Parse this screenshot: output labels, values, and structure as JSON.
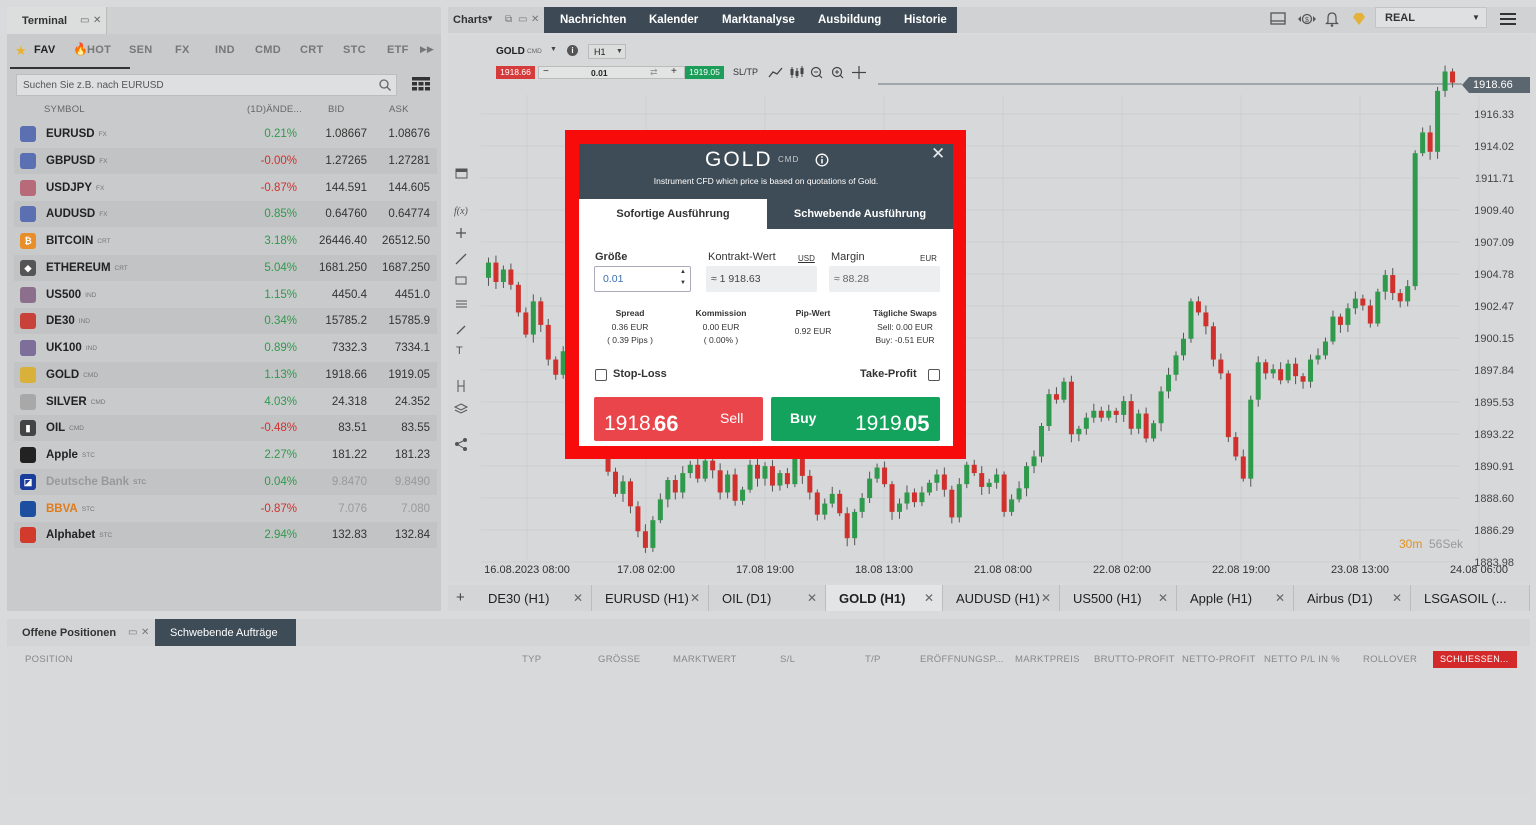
{
  "terminal": {
    "title": "Terminal",
    "categories": [
      {
        "label": "FAV",
        "icon": "star-icon"
      },
      {
        "label": "HOT",
        "icon": "flame-icon"
      },
      {
        "label": "SEN"
      },
      {
        "label": "FX"
      },
      {
        "label": "IND"
      },
      {
        "label": "CMD"
      },
      {
        "label": "CRT"
      },
      {
        "label": "STC"
      },
      {
        "label": "ETF"
      }
    ],
    "search_placeholder": "Suchen Sie z.B. nach EURUSD",
    "columns": {
      "symbol": "SYMBOL",
      "change": "(1D)ÄNDE...",
      "bid": "BID",
      "ask": "ASK"
    },
    "rows": [
      {
        "symbol": "EURUSD",
        "type": "FX",
        "change": "0.21%",
        "bid": "1.08667",
        "ask": "1.08676",
        "dir": "pos",
        "icon": "us-flag-icon",
        "icon_color": "#5b6fb3"
      },
      {
        "symbol": "GBPUSD",
        "type": "FX",
        "change": "-0.00%",
        "bid": "1.27265",
        "ask": "1.27281",
        "dir": "neg",
        "icon": "us-flag-icon",
        "icon_color": "#5b6fb3"
      },
      {
        "symbol": "USDJPY",
        "type": "FX",
        "change": "-0.87%",
        "bid": "144.591",
        "ask": "144.605",
        "dir": "neg",
        "icon": "us-flag-icon",
        "icon_color": "#b76a7a"
      },
      {
        "symbol": "AUDUSD",
        "type": "FX",
        "change": "0.85%",
        "bid": "0.64760",
        "ask": "0.64774",
        "dir": "pos",
        "icon": "us-flag-icon",
        "icon_color": "#5b6fb3"
      },
      {
        "symbol": "BITCOIN",
        "type": "CRT",
        "change": "3.18%",
        "bid": "26446.40",
        "ask": "26512.50",
        "dir": "pos",
        "icon": "bitcoin-icon",
        "icon_color": "#e88f2a"
      },
      {
        "symbol": "ETHEREUM",
        "type": "CRT",
        "change": "5.04%",
        "bid": "1681.250",
        "ask": "1687.250",
        "dir": "pos",
        "icon": "ethereum-icon",
        "icon_color": "#555555"
      },
      {
        "symbol": "US500",
        "type": "IND",
        "change": "1.15%",
        "bid": "4450.4",
        "ask": "4451.0",
        "dir": "pos",
        "icon": "us-flag-icon",
        "icon_color": "#8b6f8c"
      },
      {
        "symbol": "DE30",
        "type": "IND",
        "change": "0.34%",
        "bid": "15785.2",
        "ask": "15785.9",
        "dir": "pos",
        "icon": "de-flag-icon",
        "icon_color": "#c9423a"
      },
      {
        "symbol": "UK100",
        "type": "IND",
        "change": "0.89%",
        "bid": "7332.3",
        "ask": "7334.1",
        "dir": "pos",
        "icon": "uk-flag-icon",
        "icon_color": "#7d6f99"
      },
      {
        "symbol": "GOLD",
        "type": "CMD",
        "change": "1.13%",
        "bid": "1918.66",
        "ask": "1919.05",
        "dir": "pos",
        "icon": "gold-bar-icon",
        "icon_color": "#d9b13a"
      },
      {
        "symbol": "SILVER",
        "type": "CMD",
        "change": "4.03%",
        "bid": "24.318",
        "ask": "24.352",
        "dir": "pos",
        "icon": "silver-bar-icon",
        "icon_color": "#a8a8a8"
      },
      {
        "symbol": "OIL",
        "type": "CMD",
        "change": "-0.48%",
        "bid": "83.51",
        "ask": "83.55",
        "dir": "neg",
        "icon": "oil-barrel-icon",
        "icon_color": "#444444"
      },
      {
        "symbol": "Apple",
        "type": "STC",
        "change": "2.27%",
        "bid": "181.22",
        "ask": "181.23",
        "dir": "pos",
        "icon": "apple-logo-icon",
        "icon_color": "#222222"
      },
      {
        "symbol": "Deutsche Bank",
        "type": "STC",
        "change": "0.04%",
        "bid": "9.8470",
        "ask": "9.8490",
        "dir": "pos",
        "icon": "deutsche-bank-logo-icon",
        "icon_color": "#1a3d9c",
        "dim": true
      },
      {
        "symbol": "BBVA",
        "type": "STC",
        "change": "-0.87%",
        "bid": "7.076",
        "ask": "7.080",
        "dir": "neg",
        "icon": "bbva-logo-icon",
        "icon_color": "#1d4fa0",
        "dim": true,
        "orange": true
      },
      {
        "symbol": "Alphabet",
        "type": "STC",
        "change": "2.94%",
        "bid": "132.83",
        "ask": "132.84",
        "dir": "pos",
        "icon": "alphabet-logo-icon",
        "icon_color": "#d23a2c"
      }
    ]
  },
  "top_nav": {
    "charts_label": "Charts",
    "items": [
      "Nachrichten",
      "Kalender",
      "Marktanalyse",
      "Ausbildung",
      "Historie"
    ],
    "account_mode": "REAL"
  },
  "chart": {
    "symbol": "GOLD",
    "symbol_type": "CMD",
    "timeframe": "H1",
    "sell_price": "1918.66",
    "volume": "0.01",
    "buy_price": "1919.05",
    "sltp_label": "SL/TP",
    "current_price_label": "1918.66",
    "countdown_min": "30m",
    "countdown_sec": "56Sek",
    "y_ticks": [
      "1916.33",
      "1914.02",
      "1911.71",
      "1909.40",
      "1907.09",
      "1904.78",
      "1902.47",
      "1900.15",
      "1897.84",
      "1895.53",
      "1893.22",
      "1890.91",
      "1888.60",
      "1886.29",
      "1883.98"
    ],
    "x_ticks": [
      "16.08.2023 08:00",
      "17.08 02:00",
      "17.08 19:00",
      "18.08 13:00",
      "21.08 08:00",
      "22.08 02:00",
      "22.08 19:00",
      "23.08 13:00",
      "24.08 06:00"
    ]
  },
  "chart_tabs": [
    {
      "label": "DE30 (H1)",
      "active": false
    },
    {
      "label": "EURUSD (H1)",
      "active": false
    },
    {
      "label": "OIL (D1)",
      "active": false
    },
    {
      "label": "GOLD (H1)",
      "active": true
    },
    {
      "label": "AUDUSD (H1)",
      "active": false
    },
    {
      "label": "US500 (H1)",
      "active": false
    },
    {
      "label": "Apple (H1)",
      "active": false
    },
    {
      "label": "Airbus (D1)",
      "active": false
    },
    {
      "label": "LSGASOIL (...",
      "active": false
    }
  ],
  "bottom": {
    "tab_open": "Offene Positionen",
    "tab_pending": "Schwebende Aufträge",
    "columns": [
      "POSITION",
      "TYP",
      "GRÖSSE",
      "MARKTWERT",
      "S/L",
      "T/P",
      "ERÖFFNUNGSP...",
      "MARKTPREIS",
      "BRUTTO-PROFIT",
      "NETTO-PROFIT",
      "NETTO P/L IN %",
      "ROLLOVER"
    ],
    "close_button": "SCHLIESSEN..."
  },
  "modal": {
    "title": "GOLD",
    "badge": "CMD",
    "subtitle": "Instrument CFD which price is based on quotations of Gold.",
    "tab_instant": "Sofortige Ausführung",
    "tab_pending": "Schwebende Ausführung",
    "size_label": "Größe",
    "size_value": "0.01",
    "contract_label": "Kontrakt-Wert",
    "contract_currency": "USD",
    "contract_value": "≈ 1 918.63",
    "margin_label": "Margin",
    "margin_currency": "EUR",
    "margin_value": "≈ 88.28",
    "spread_label": "Spread",
    "spread_value": "0.36 EUR",
    "spread_pips": "( 0.39 Pips )",
    "commission_label": "Kommission",
    "commission_value": "0.00 EUR",
    "commission_pct": "( 0.00% )",
    "pip_label": "Pip-Wert",
    "pip_value": "0.92 EUR",
    "swaps_label": "Tägliche Swaps",
    "swaps_sell": "Sell: 0.00 EUR",
    "swaps_buy": "Buy: -0.51 EUR",
    "stop_loss": "Stop-Loss",
    "take_profit": "Take-Profit",
    "sell_label": "Sell",
    "sell_price_main": "1918.",
    "sell_price_big": "66",
    "buy_label": "Buy",
    "buy_price_main": "1919.",
    "buy_price_big": "05"
  },
  "colors": {
    "sell": "#e9454a",
    "buy": "#14a35d",
    "highlight_frame": "#f70b0b",
    "panel_dark": "#3e4c57",
    "candle_up": "#2f9a4c",
    "candle_down": "#d0312d"
  }
}
